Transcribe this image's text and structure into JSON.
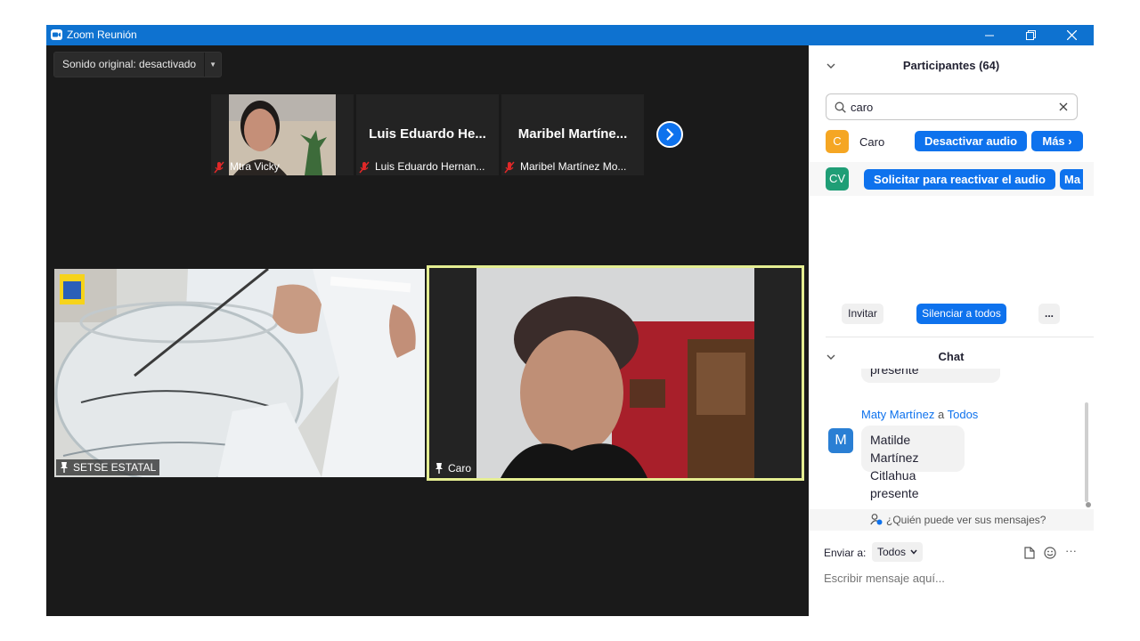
{
  "window": {
    "title": "Zoom Reunión"
  },
  "meeting": {
    "sound_button": "Sonido original: desactivado",
    "thumbnails": [
      {
        "caption": "Mtra Vicky"
      },
      {
        "name": "Luis  Eduardo  He...",
        "caption": "Luis Eduardo Hernan..."
      },
      {
        "name": "Maribel  Martíne...",
        "caption": "Maribel Martínez Mo..."
      }
    ],
    "videos": [
      {
        "caption": "SETSE ESTATAL"
      },
      {
        "caption": "Caro"
      }
    ]
  },
  "participants": {
    "header": "Participantes (64)",
    "search_value": "caro",
    "rows": [
      {
        "initials": "C",
        "name": "Caro",
        "action": "Desactivar audio",
        "more": "Más ›",
        "color": "#f5a623"
      },
      {
        "initials": "CV",
        "action": "Solicitar para reactivar el audio",
        "more": "Ma",
        "color": "#1f9e76"
      }
    ],
    "invite": "Invitar",
    "mute_all": "Silenciar a todos",
    "more_options": "..."
  },
  "chat": {
    "header": "Chat",
    "prev_message_tail": "presente",
    "message": {
      "avatar": "M",
      "sender": "Maty Martínez",
      "connector": "a",
      "recipient": "Todos",
      "line1": "Matilde Martínez",
      "line2": "Citlahua presente"
    },
    "who_can_see": "¿Quién puede ver sus mensajes?",
    "send_to_label": "Enviar a:",
    "send_to_value": "Todos",
    "input_placeholder": "Escribir mensaje aquí...",
    "more_options": "···"
  },
  "colors": {
    "accent": "#0e72ed",
    "titlebar": "#0e72d0",
    "speaker_border": "#e5ee92",
    "background": "#1a1a1a"
  }
}
